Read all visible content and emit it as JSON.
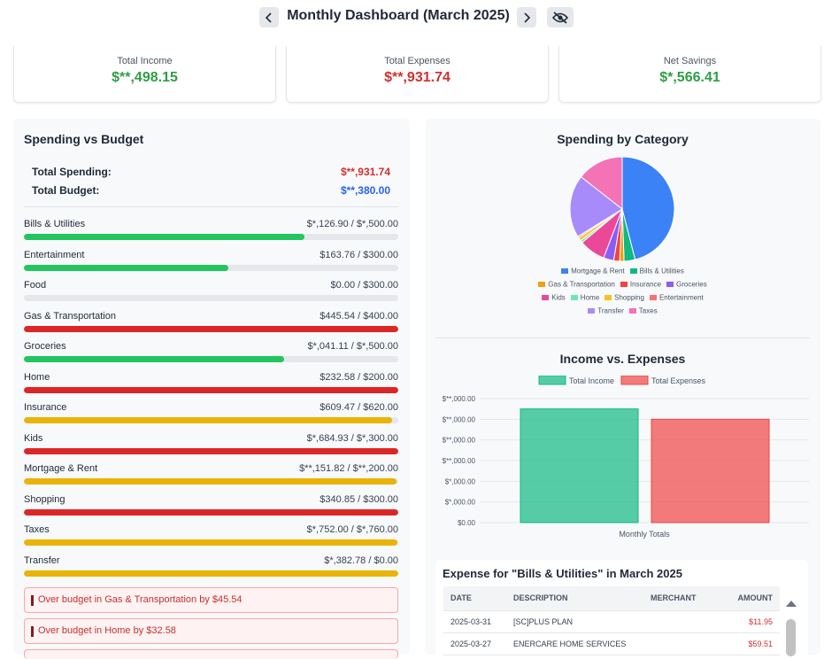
{
  "header": {
    "title": "Monthly Dashboard (March 2025)"
  },
  "summary": [
    {
      "label": "Total Income",
      "value": "$**,498.15",
      "color": "#2f9e44"
    },
    {
      "label": "Total Expenses",
      "value": "$**,931.74",
      "color": "#d32f2f"
    },
    {
      "label": "Net Savings",
      "value": "$*,566.41",
      "color": "#2f9e44"
    }
  ],
  "budget": {
    "title": "Spending vs Budget",
    "total_spending_label": "Total Spending:",
    "total_spending": "$**,931.74",
    "total_budget_label": "Total Budget:",
    "total_budget": "$**,380.00",
    "rows": [
      {
        "name": "Bills & Utilities",
        "amount": "$*,126.90 / $*,500.00",
        "pct": 0.75,
        "color": "#22c55e"
      },
      {
        "name": "Entertainment",
        "amount": "$163.76 / $300.00",
        "pct": 0.545,
        "color": "#22c55e"
      },
      {
        "name": "Food",
        "amount": "$0.00 / $300.00",
        "pct": 0.0,
        "color": "#22c55e"
      },
      {
        "name": "Gas & Transportation",
        "amount": "$445.54 / $400.00",
        "pct": 1.0,
        "color": "#dc2626"
      },
      {
        "name": "Groceries",
        "amount": "$*,041.11 / $*,500.00",
        "pct": 0.695,
        "color": "#22c55e"
      },
      {
        "name": "Home",
        "amount": "$232.58 / $200.00",
        "pct": 1.0,
        "color": "#dc2626"
      },
      {
        "name": "Insurance",
        "amount": "$609.47 / $620.00",
        "pct": 0.983,
        "color": "#eab308"
      },
      {
        "name": "Kids",
        "amount": "$*,684.93 / $*,300.00",
        "pct": 1.0,
        "color": "#dc2626"
      },
      {
        "name": "Mortgage & Rent",
        "amount": "$**,151.82 / $**,200.00",
        "pct": 0.996,
        "color": "#eab308"
      },
      {
        "name": "Shopping",
        "amount": "$340.85 / $300.00",
        "pct": 1.0,
        "color": "#dc2626"
      },
      {
        "name": "Taxes",
        "amount": "$*,752.00 / $*,760.00",
        "pct": 0.997,
        "color": "#eab308"
      },
      {
        "name": "Transfer",
        "amount": "$*,382.78 / $0.00",
        "pct": 1.0,
        "color": "#eab308"
      }
    ],
    "alerts": [
      "Over budget in Gas & Transportation by $45.54",
      "Over budget in Home by $32.58"
    ]
  },
  "category_chart": {
    "title": "Spending by Category",
    "legend": [
      {
        "name": "Mortgage & Rent",
        "color": "#3b82f6"
      },
      {
        "name": "Bills & Utilities",
        "color": "#10b981"
      },
      {
        "name": "Gas & Transportation",
        "color": "#f59e0b"
      },
      {
        "name": "Insurance",
        "color": "#ef4444"
      },
      {
        "name": "Groceries",
        "color": "#8b5cf6"
      },
      {
        "name": "Kids",
        "color": "#ec4899"
      },
      {
        "name": "Home",
        "color": "#6ee7b7"
      },
      {
        "name": "Shopping",
        "color": "#fbbf24"
      },
      {
        "name": "Entertainment",
        "color": "#f87171"
      },
      {
        "name": "Transfer",
        "color": "#a78bfa"
      },
      {
        "name": "Taxes",
        "color": "#f472b6"
      }
    ]
  },
  "chart_data": [
    {
      "type": "pie",
      "title": "Spending by Category",
      "categories": [
        "Mortgage & Rent",
        "Bills & Utilities",
        "Gas & Transportation",
        "Insurance",
        "Groceries",
        "Kids",
        "Home",
        "Shopping",
        "Entertainment",
        "Transfer",
        "Taxes"
      ],
      "values": [
        15151.82,
        1126.9,
        445.54,
        609.47,
        1041.11,
        2684.93,
        232.58,
        340.85,
        163.76,
        6382.78,
        4752.0
      ]
    },
    {
      "type": "bar",
      "title": "Income vs. Expenses",
      "categories": [
        "Monthly Totals"
      ],
      "series": [
        {
          "name": "Total Income",
          "values": [
            33000
          ],
          "color": "#10b981"
        },
        {
          "name": "Total Expenses",
          "values": [
            30000
          ],
          "color": "#ef4444"
        }
      ],
      "ylim": [
        0,
        36000
      ],
      "yticks": [
        "$0.00",
        "$*,000.00",
        "$*,000.00",
        "$**,000.00",
        "$**,000.00",
        "$**,000.00",
        "$**,000.00"
      ],
      "grid": true,
      "legend": "top"
    }
  ],
  "income_chart": {
    "title": "Income vs. Expenses",
    "xtick": "Monthly Totals",
    "legend": [
      "Total Income",
      "Total Expenses"
    ]
  },
  "expense_table": {
    "title": "Expense for \"Bills & Utilities\" in March 2025",
    "headers": [
      "DATE",
      "DESCRIPTION",
      "MERCHANT",
      "AMOUNT"
    ],
    "rows": [
      {
        "date": "2025-03-31",
        "description": "[SC]PLUS PLAN",
        "merchant": "",
        "amount": "$11.95"
      },
      {
        "date": "2025-03-27",
        "description": "ENERCARE HOME SERVICES",
        "merchant": "",
        "amount": "$59.51"
      }
    ]
  }
}
